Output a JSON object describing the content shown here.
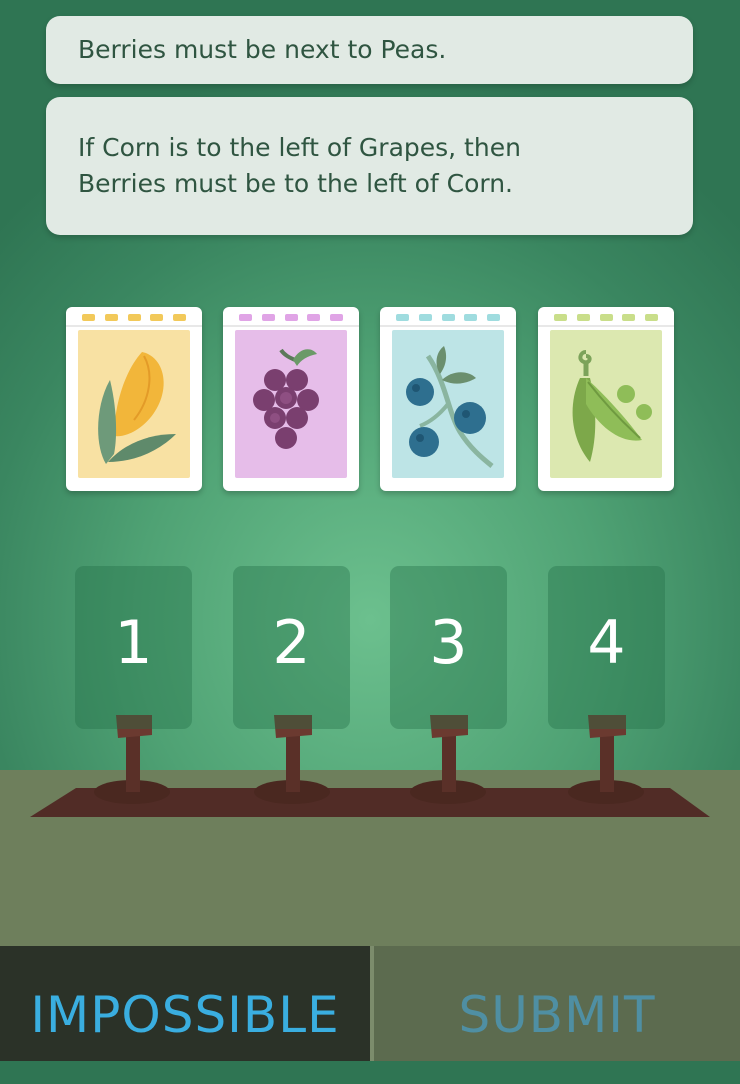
{
  "clues": [
    {
      "text": "Berries must be next to Peas."
    },
    {
      "line1": "If Corn is to the left of Grapes, then",
      "line2": "Berries must be to the left of Corn."
    }
  ],
  "packets": [
    {
      "name": "Corn",
      "icon": "corn-icon",
      "bg": "#f8e1a3",
      "dash": "#f2c95a"
    },
    {
      "name": "Grapes",
      "icon": "grapes-icon",
      "bg": "#e6bde9",
      "dash": "#e0a4e6"
    },
    {
      "name": "Berries",
      "icon": "blueberries-icon",
      "bg": "#bde4e6",
      "dash": "#9fdcdf"
    },
    {
      "name": "Peas",
      "icon": "peas-icon",
      "bg": "#dce8b0",
      "dash": "#c9de8a"
    }
  ],
  "slots": [
    "1",
    "2",
    "3",
    "4"
  ],
  "buttons": {
    "impossible": "IMPOSSIBLE",
    "submit": "SUBMIT"
  },
  "colors": {
    "clue_text": "#2f5541",
    "impossible": "#3aaee0",
    "submit": "#4f8fa3"
  }
}
